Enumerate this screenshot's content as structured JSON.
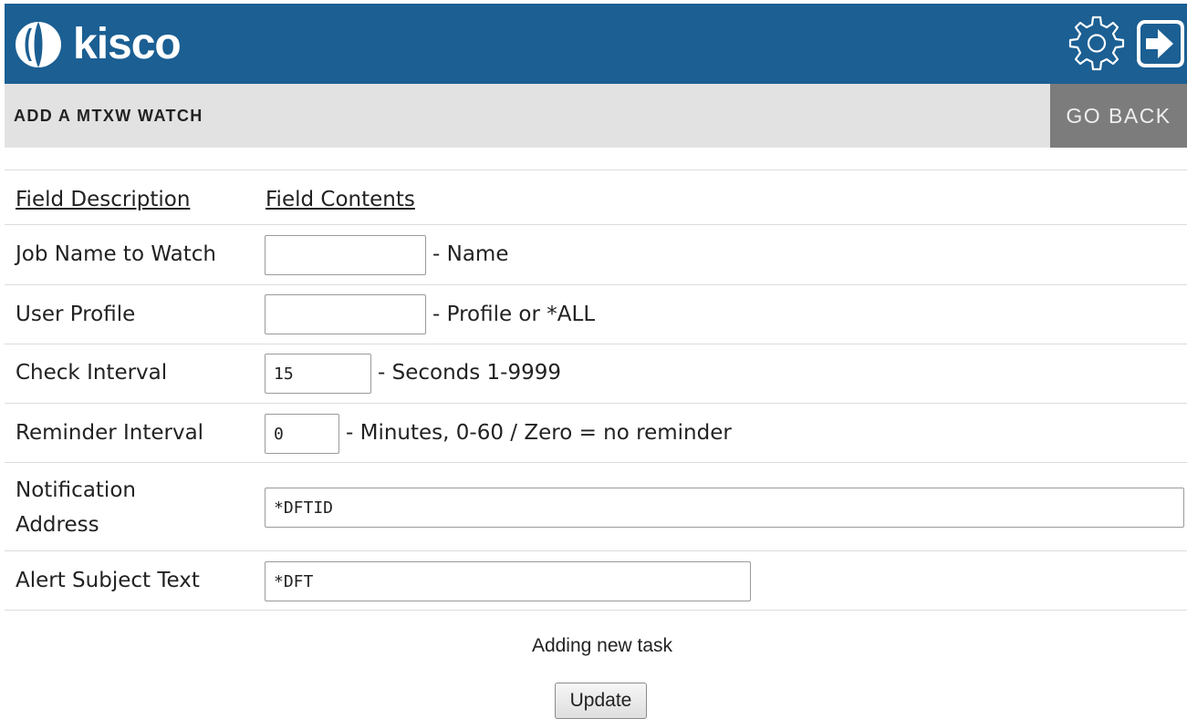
{
  "header": {
    "brand": "kisco",
    "settings_icon": "gear-icon",
    "exit_icon": "logout-icon",
    "bg_color": "#1b5f93"
  },
  "title_bar": {
    "title": "ADD A MTXW WATCH",
    "go_back_label": "GO BACK"
  },
  "table": {
    "columns": [
      "Field Description",
      "Field Contents"
    ],
    "rows": [
      {
        "label": "Job Name to Watch",
        "value": "",
        "hint": "- Name"
      },
      {
        "label": "User Profile",
        "value": "",
        "hint": "- Profile or *ALL"
      },
      {
        "label": "Check Interval",
        "value": "15",
        "hint": "- Seconds 1-9999"
      },
      {
        "label": "Reminder Interval",
        "value": "0",
        "hint": "- Minutes, 0-60 / Zero = no reminder"
      },
      {
        "label_line1": "Notification",
        "label_line2": "Address",
        "value": "*DFTID"
      },
      {
        "label": "Alert Subject Text",
        "value": "*DFT"
      }
    ]
  },
  "status": {
    "message": "Adding new task"
  },
  "update_label": "Update"
}
